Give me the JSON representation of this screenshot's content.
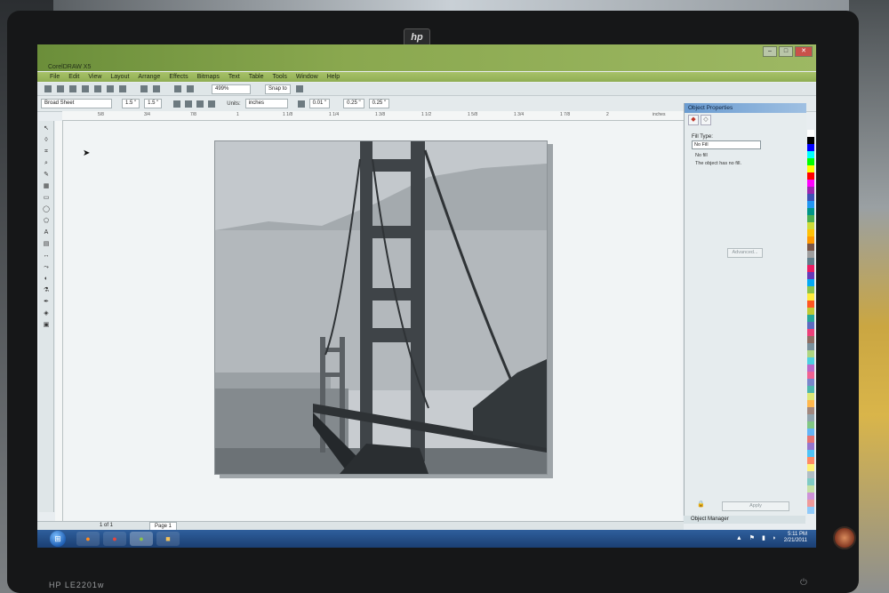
{
  "monitor": {
    "brand": "hp",
    "model": "HP LE2201w"
  },
  "window": {
    "title": "CorelDRAW X5",
    "controls": {
      "minimize": "–",
      "maximize": "□",
      "close": "✕"
    }
  },
  "menubar": [
    "File",
    "Edit",
    "View",
    "Layout",
    "Arrange",
    "Effects",
    "Bitmaps",
    "Text",
    "Table",
    "Tools",
    "Window",
    "Help"
  ],
  "toolbar": {
    "zoom": "499%",
    "snap": "Snap to",
    "paper": "Broad Sheet",
    "width": "1.5 \"",
    "height": "1.5 \"",
    "units_label": "Units:",
    "units_value": "inches",
    "nudge": "0.01 \"",
    "dup_x": "0.25 \"",
    "dup_y": "0.25 \""
  },
  "ruler": {
    "labels": [
      "5/8",
      "3/4",
      "7/8",
      "1",
      "1 1/8",
      "1 1/4",
      "1 3/8",
      "1 1/2",
      "1 5/8",
      "1 3/4",
      "1 7/8",
      "2",
      "inches"
    ]
  },
  "docker": {
    "title": "Object Properties",
    "fill_type_label": "Fill Type:",
    "fill_type_value": "No Fill",
    "fill_desc": "No fill",
    "fill_desc2": "The object has no fill.",
    "advanced": "Advanced...",
    "apply": "Apply",
    "object_manager": "Object Manager"
  },
  "statusbar": {
    "page_count": "1 of 1",
    "page_tab": "Page 1"
  },
  "taskbar": {
    "time": "5:11 PM",
    "date": "2/21/2011"
  },
  "palette": [
    "#ffffff",
    "#000000",
    "#0000ff",
    "#00ffff",
    "#00ff00",
    "#ffff00",
    "#ff0000",
    "#ff00ff",
    "#9c27b0",
    "#3f51b5",
    "#2196f3",
    "#009688",
    "#4caf50",
    "#cddc39",
    "#ffc107",
    "#ff9800",
    "#795548",
    "#9e9e9e",
    "#607d8b",
    "#e91e63",
    "#673ab7",
    "#03a9f4",
    "#8bc34a",
    "#ffeb3b",
    "#ff5722",
    "#c0ca33",
    "#26a69a",
    "#5c6bc0",
    "#ec407a",
    "#8d6e63",
    "#78909c",
    "#aed581",
    "#4dd0e1",
    "#ba68c8",
    "#f06292",
    "#7986cb",
    "#4db6ac",
    "#dce775",
    "#ffb74d",
    "#a1887f",
    "#90a4ae",
    "#81c784",
    "#64b5f6",
    "#e57373",
    "#9575cd",
    "#4fc3f7",
    "#ff8a65",
    "#fff176",
    "#b0bec5",
    "#80cbc4",
    "#c5e1a5",
    "#ce93d8",
    "#ef9a9a",
    "#90caf9"
  ]
}
